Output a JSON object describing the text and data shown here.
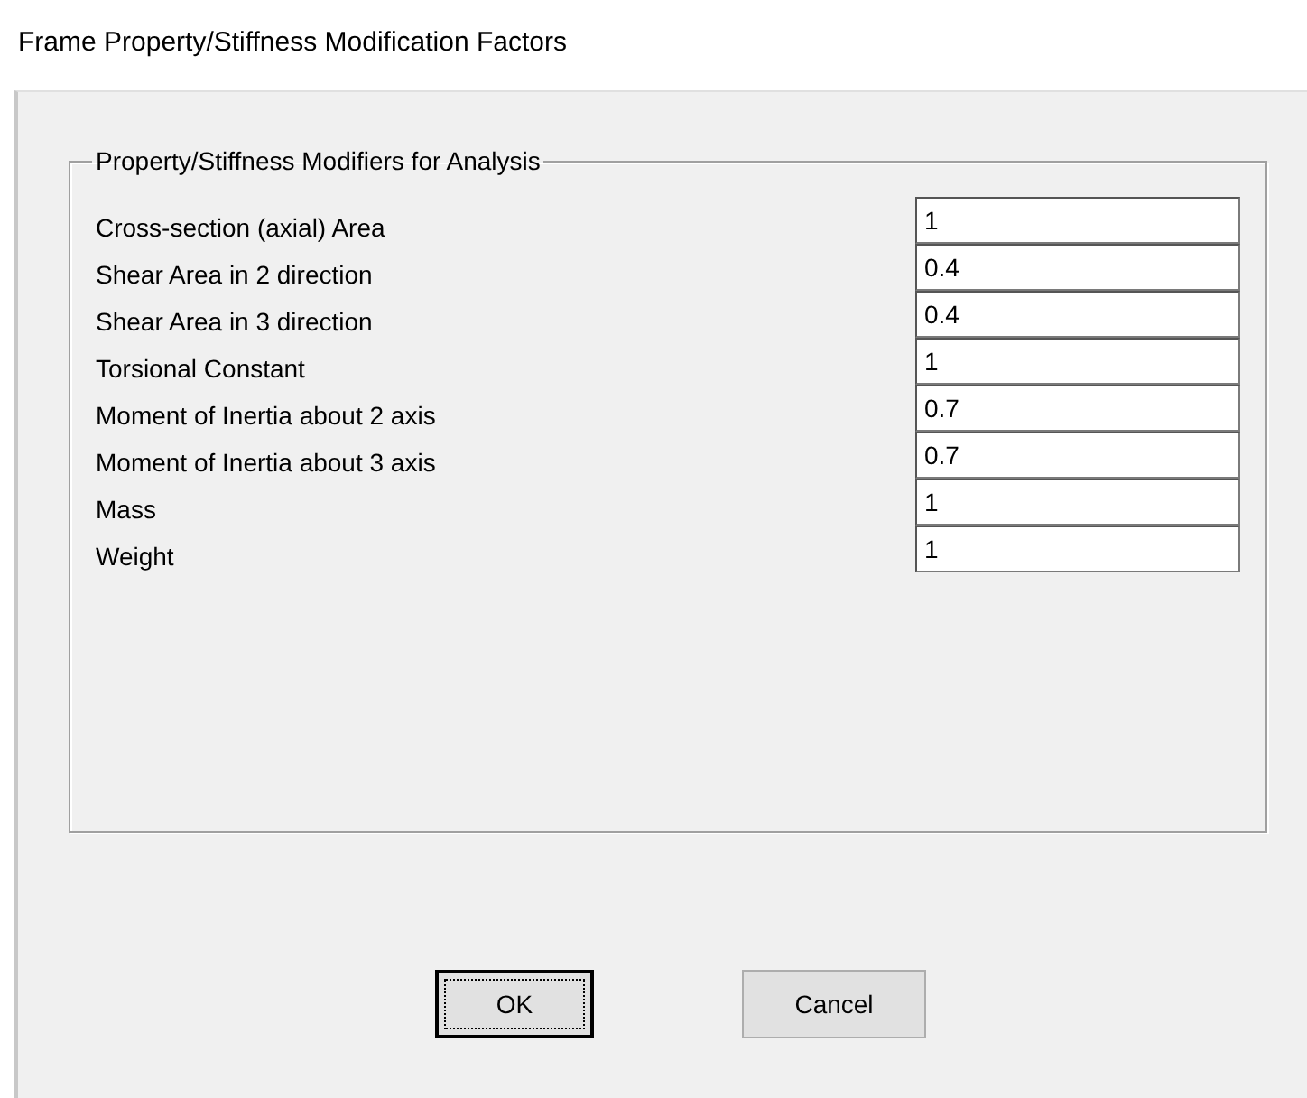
{
  "window": {
    "title": "Frame Property/Stiffness Modification Factors"
  },
  "group": {
    "title": "Property/Stiffness Modifiers for Analysis",
    "fields": [
      {
        "label": "Cross-section (axial) Area",
        "value": "1"
      },
      {
        "label": "Shear Area in 2 direction",
        "value": "0.4"
      },
      {
        "label": "Shear Area in 3 direction",
        "value": "0.4"
      },
      {
        "label": "Torsional Constant",
        "value": "1"
      },
      {
        "label": "Moment of Inertia about 2 axis",
        "value": "0.7"
      },
      {
        "label": "Moment of Inertia about 3 axis",
        "value": "0.7"
      },
      {
        "label": "Mass",
        "value": "1"
      },
      {
        "label": "Weight",
        "value": "1"
      }
    ]
  },
  "buttons": [
    {
      "label": "OK",
      "default": true
    },
    {
      "label": "Cancel",
      "default": false
    }
  ]
}
